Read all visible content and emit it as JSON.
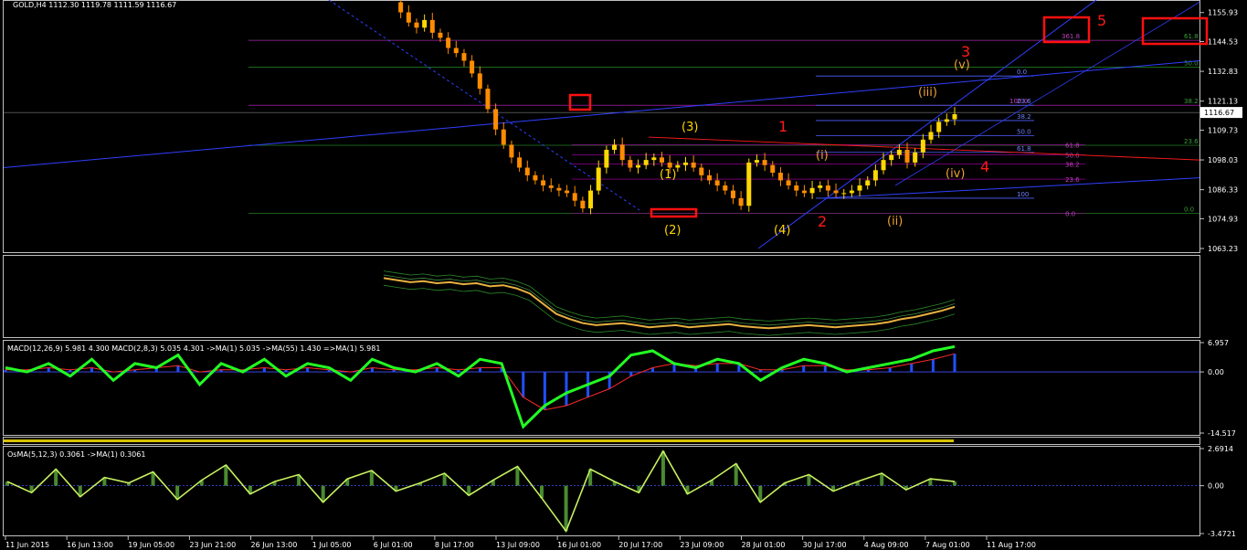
{
  "colors": {
    "background": "#000000",
    "frame": "#c0c0c0",
    "candle_up": "#ffd800",
    "candle_down": "#ff8c00",
    "trend_blue": "#2f3fff",
    "fib_green": "#1f7a1f",
    "fib_purple": "#b000b0",
    "wave_red": "#ff1a1a",
    "wave_yellow": "#ffd400",
    "wave_orange": "#f0a030",
    "macd_main": "#22ff22",
    "macd_signal": "#ff2a2a",
    "macd_hist": "#2050ff",
    "osma": "#c8f060"
  },
  "chart_data": [
    {
      "type": "candlestick",
      "title": "GOLD,H4  1112.30 1119.78 1111.59 1116.67",
      "symbol": "GOLD",
      "timeframe": "H4",
      "ohlc_header": [
        "1112.30",
        "1119.78",
        "1111.59",
        "1116.67"
      ],
      "current_price": "1116.67",
      "ylim": [
        1063.23,
        1160.5
      ],
      "y_ticks": [
        "1155.93",
        "1144.53",
        "1132.83",
        "1121.13",
        "1109.73",
        "1098.03",
        "1086.33",
        "1074.93",
        "1063.23"
      ],
      "x_ticks": [
        "11 Jun 2015",
        "16 Jun 13:00",
        "19 Jun 05:00",
        "23 Jun 21:00",
        "26 Jun 13:00",
        "1 Jul 05:00",
        "6 Jul 01:00",
        "8 Jul 17:00",
        "13 Jul 09:00",
        "16 Jul 01:00",
        "20 Jul 17:00",
        "23 Jul 09:00",
        "28 Jul 01:00",
        "30 Jul 17:00",
        "4 Aug 09:00",
        "7 Aug 01:00",
        "11 Aug 17:00"
      ],
      "price_path": [
        1160,
        1156,
        1152,
        1150,
        1153,
        1148,
        1146,
        1142,
        1140,
        1137,
        1132,
        1126,
        1118,
        1110,
        1104,
        1099,
        1095,
        1092,
        1090,
        1088,
        1087,
        1086,
        1085,
        1082,
        1079,
        1086,
        1095,
        1102,
        1104,
        1098,
        1095,
        1096,
        1098,
        1099,
        1097,
        1095,
        1096,
        1097,
        1095,
        1092,
        1090,
        1088,
        1086,
        1083,
        1080,
        1097,
        1098,
        1096,
        1093,
        1090,
        1088,
        1086,
        1085,
        1087,
        1088,
        1086,
        1085,
        1085,
        1086,
        1088,
        1090,
        1094,
        1098,
        1100,
        1102,
        1097,
        1101,
        1106,
        1109,
        1113,
        1114,
        1116
      ],
      "fib_levels_right": [
        "61.8",
        "50.0",
        "38.2",
        "23.6",
        "0.0"
      ],
      "fib_levels_right_values": [
        1145,
        1134.5,
        1119.5,
        1103.8,
        1077.0
      ],
      "fib_extension_labels": [
        "361.8",
        "100.0"
      ],
      "fib_extension_values": [
        1145,
        1119.5
      ],
      "fib_levels_mid": [
        "0.0",
        "23.6",
        "38.2",
        "50.0",
        "61.8",
        "100"
      ],
      "fib_levels_mid_values": [
        1131,
        1119.5,
        1113.5,
        1107.5,
        1101,
        1083
      ],
      "fib_levels_small": [
        "61.8",
        "50.0",
        "38.2",
        "23.6",
        "0.0"
      ],
      "fib_levels_small_values": [
        1104,
        1100,
        1096.5,
        1090.5,
        1077.0
      ],
      "wave_labels": {
        "red": [
          "1",
          "2",
          "3",
          "4",
          "5"
        ],
        "yellow": [
          "(1)",
          "(2)",
          "(3)",
          "(4)"
        ],
        "orange": [
          "(i)",
          "(ii)",
          "(iii)",
          "(iv)",
          "(v)"
        ]
      }
    },
    {
      "type": "line",
      "title": "",
      "series": [
        {
          "values": [
            20,
            22,
            24,
            23,
            25,
            24,
            26,
            25,
            28,
            27,
            30,
            35,
            45,
            55,
            60,
            64,
            66,
            65,
            64,
            66,
            68,
            67,
            66,
            68,
            67,
            66,
            65,
            67,
            68,
            69,
            68,
            67,
            66,
            67,
            68,
            67,
            66,
            65,
            63,
            60,
            58,
            55,
            52,
            48
          ]
        }
      ]
    },
    {
      "type": "line",
      "title": "MACD(12,26,9) 5.981 4.300  MACD(2,8,3) 5.035 4.301  ->MA(1) 5.035  ->MA(55) 1.430  =>MA(1) 5.981",
      "y_ticks": [
        "6.957",
        "0.00",
        "-14.517"
      ],
      "ylim": [
        -14.517,
        6.957
      ],
      "series": [
        {
          "values": [
            1,
            0,
            2,
            -1,
            3,
            -2,
            2,
            1,
            4,
            -3,
            2,
            0,
            3,
            -1,
            2,
            1,
            -2,
            3,
            1,
            0,
            2,
            -1,
            3,
            2,
            -13,
            -8,
            -5,
            -3,
            -1,
            4,
            5,
            2,
            1,
            3,
            2,
            -2,
            1,
            3,
            2,
            0,
            1,
            2,
            3,
            5,
            6
          ]
        },
        {
          "values": [
            0.5,
            0.5,
            1,
            0.5,
            1,
            0,
            0.5,
            1,
            1.5,
            0,
            0.5,
            0.5,
            1,
            0.5,
            1,
            0.5,
            0,
            1,
            0.5,
            0.5,
            1,
            0.5,
            1,
            1,
            -6,
            -9,
            -8,
            -6,
            -4,
            -1,
            1,
            2,
            1.5,
            2,
            2,
            0.5,
            0.5,
            1.5,
            1.5,
            0.5,
            0.5,
            1,
            2,
            3,
            4.3
          ]
        }
      ]
    },
    {
      "type": "line",
      "title": "OsMA(5,12,3) 0.3061  ->MA(1) 0.3061",
      "y_ticks": [
        "2.6914",
        "0.00",
        "-3.4721"
      ],
      "ylim": [
        -3.4721,
        2.6914
      ],
      "series": [
        {
          "values": [
            0.3,
            -0.5,
            1.2,
            -0.8,
            0.6,
            0.2,
            1.0,
            -1.0,
            0.4,
            1.5,
            -0.6,
            0.3,
            0.8,
            -1.2,
            0.5,
            1.1,
            -0.4,
            0.2,
            0.9,
            -0.7,
            0.4,
            1.4,
            -0.9,
            -3.3,
            1.2,
            0.3,
            -0.5,
            2.5,
            -0.6,
            0.4,
            1.6,
            -1.2,
            0.2,
            0.8,
            -0.4,
            0.3,
            0.9,
            -0.3,
            0.5,
            0.3
          ]
        }
      ]
    }
  ],
  "header": {
    "title": "GOLD,H4  1112.30 1119.78 1111.59 1116.67"
  }
}
